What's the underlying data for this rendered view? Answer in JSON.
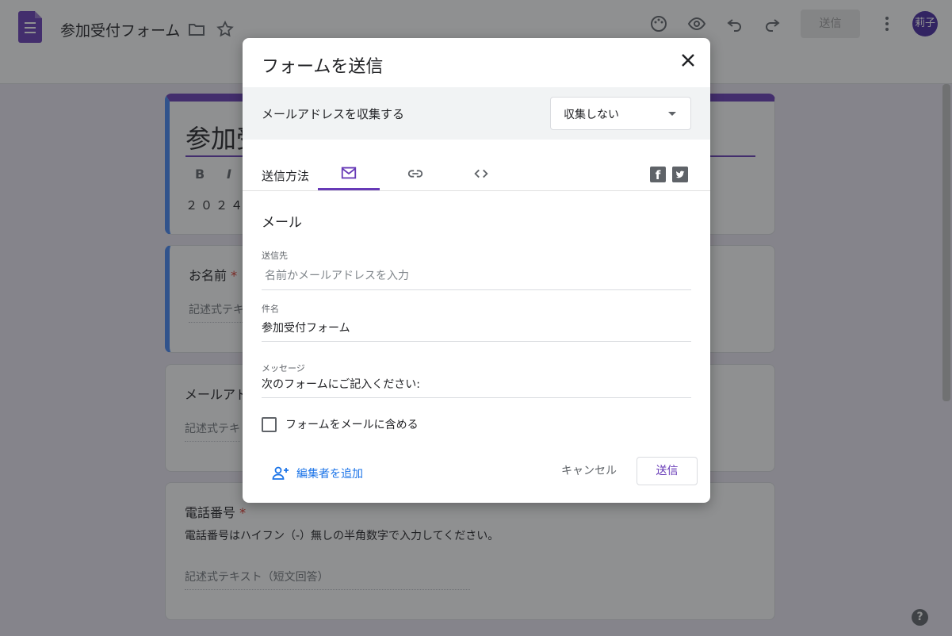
{
  "app": {
    "doc_title": "参加受付フォーム",
    "send_button": "送信",
    "avatar_initials": "莉子",
    "accent_color": "#673ab7"
  },
  "form": {
    "title": "参加受",
    "format_bold": "B",
    "format_italic": "I",
    "description": "２０２４年",
    "questions": [
      {
        "label": "お名前",
        "required": "*",
        "placeholder": "記述式テキ"
      },
      {
        "label": "メールアド",
        "placeholder": "記述式テキ"
      },
      {
        "label": "電話番号",
        "required": "*",
        "help": "電話番号はハイフン（-）無しの半角数字で入力してください。",
        "placeholder": "記述式テキスト（短文回答）"
      }
    ],
    "help_button": "?"
  },
  "dialog": {
    "title": "フォームを送信",
    "collect_label": "メールアドレスを収集する",
    "collect_value": "収集しない",
    "send_via_label": "送信方法",
    "tabs": [
      {
        "icon": "mail-icon",
        "selected": true
      },
      {
        "icon": "link-icon",
        "selected": false
      },
      {
        "icon": "embed-code-icon",
        "selected": false
      }
    ],
    "social": [
      "facebook-icon",
      "twitter-icon"
    ],
    "section_title": "メール",
    "to_label": "送信先",
    "to_placeholder": "名前かメールアドレスを入力",
    "subject_label": "件名",
    "subject_value": "参加受付フォーム",
    "message_label": "メッセージ",
    "message_value": "次のフォームにご記入ください:",
    "include_form_label": "フォームをメールに含める",
    "include_form_checked": false,
    "add_editor_label": "編集者を追加",
    "cancel_label": "キャンセル",
    "send_label": "送信"
  }
}
